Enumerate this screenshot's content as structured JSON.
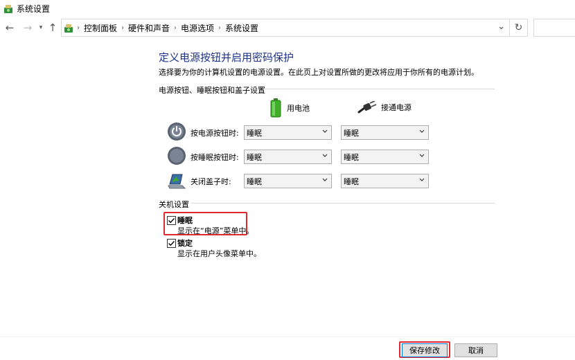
{
  "window": {
    "title": "系统设置"
  },
  "address_bar": {
    "breadcrumbs": [
      "控制面板",
      "硬件和声音",
      "电源选项",
      "系统设置"
    ]
  },
  "page": {
    "heading": "定义电源按钮并启用密码保护",
    "description": "选择要为你的计算机设置的电源设置。在此页上对设置所做的更改将应用于你所有的电源计划。"
  },
  "power_section": {
    "title": "电源按钮、睡眠按钮和盖子设置",
    "columns": {
      "battery": "用电池",
      "plugged_in": "接通电源"
    },
    "rows": [
      {
        "label": "按电源按钮时:",
        "icon": "power-button-icon",
        "battery": "睡眠",
        "plugged_in": "睡眠"
      },
      {
        "label": "按睡眠按钮时:",
        "icon": "sleep-button-icon",
        "battery": "睡眠",
        "plugged_in": "睡眠"
      },
      {
        "label": "关闭盖子时:",
        "icon": "laptop-lid-icon",
        "battery": "睡眠",
        "plugged_in": "睡眠"
      }
    ]
  },
  "shutdown_section": {
    "title": "关机设置",
    "options": [
      {
        "label": "睡眠",
        "description": "显示在“电源”菜单中。",
        "checked": true
      },
      {
        "label": "锁定",
        "description": "显示在用户头像菜单中。",
        "checked": true
      }
    ]
  },
  "buttons": {
    "save": "保存修改",
    "cancel": "取消"
  },
  "colors": {
    "heading": "#1e3287",
    "highlight": "#e0282e",
    "battery_green": "#3fae29"
  }
}
